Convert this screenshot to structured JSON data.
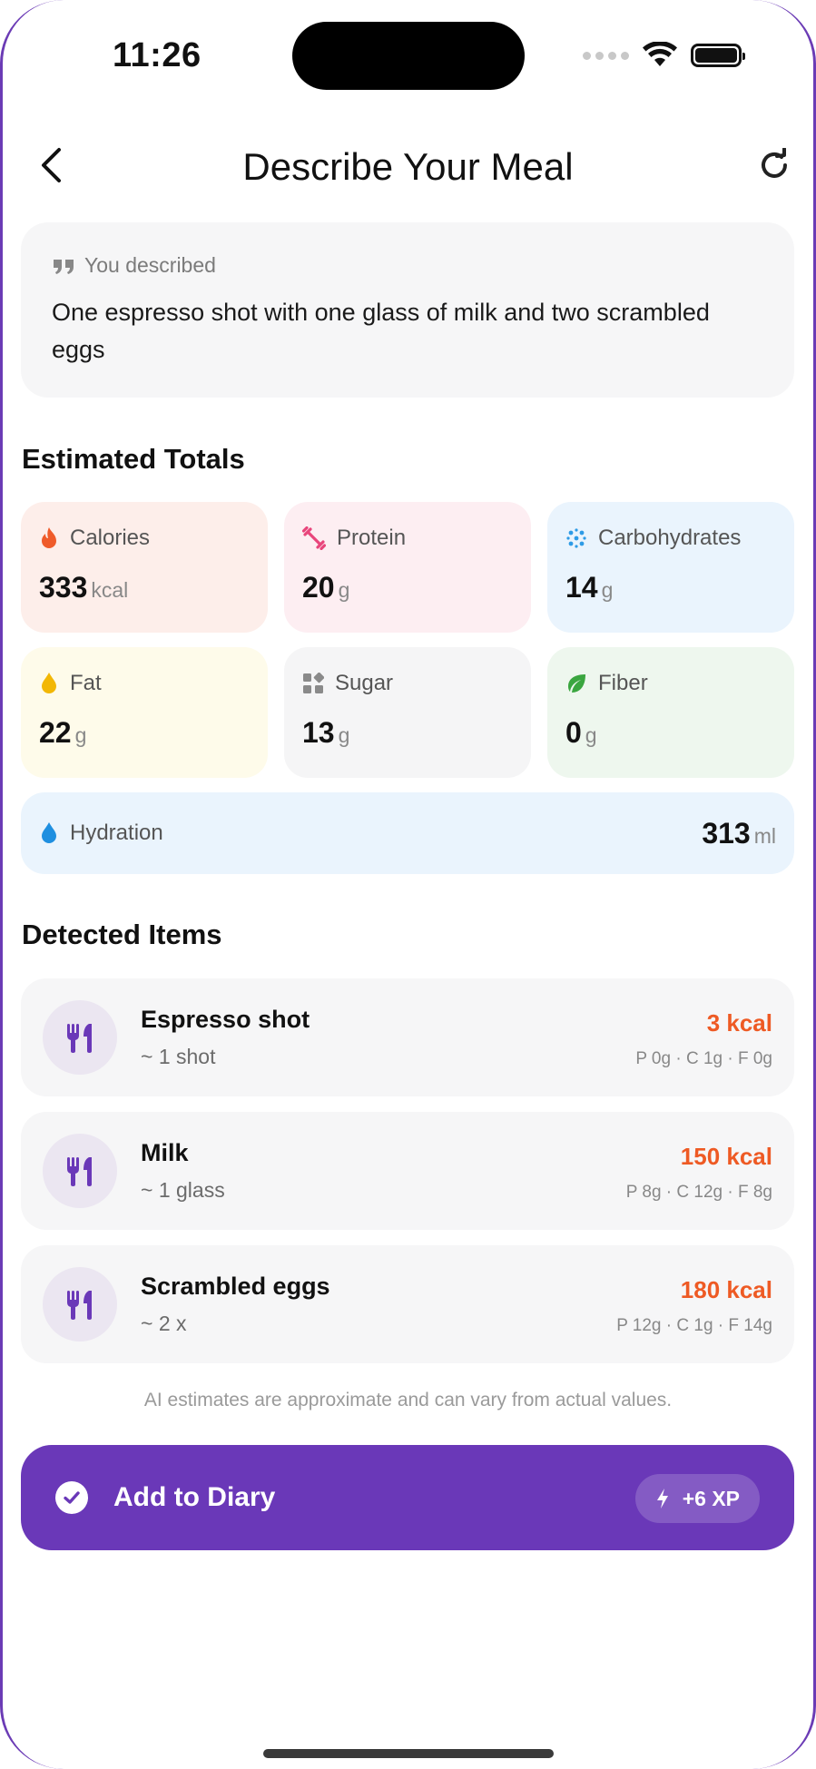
{
  "status_bar": {
    "time": "11:26"
  },
  "header": {
    "title": "Describe Your Meal"
  },
  "description": {
    "label": "You described",
    "text": "One espresso shot with one glass of milk and two scrambled eggs"
  },
  "totals": {
    "title": "Estimated Totals",
    "calories": {
      "label": "Calories",
      "value": "333",
      "unit": "kcal"
    },
    "protein": {
      "label": "Protein",
      "value": "20",
      "unit": "g"
    },
    "carbs": {
      "label": "Carbohydrates",
      "value": "14",
      "unit": "g"
    },
    "fat": {
      "label": "Fat",
      "value": "22",
      "unit": "g"
    },
    "sugar": {
      "label": "Sugar",
      "value": "13",
      "unit": "g"
    },
    "fiber": {
      "label": "Fiber",
      "value": "0",
      "unit": "g"
    },
    "hydration": {
      "label": "Hydration",
      "value": "313",
      "unit": "ml"
    }
  },
  "items": {
    "title": "Detected Items",
    "list": [
      {
        "name": "Espresso shot",
        "qty": "~ 1 shot",
        "kcal": "3 kcal",
        "macros": "P 0g · C 1g · F 0g"
      },
      {
        "name": "Milk",
        "qty": "~ 1 glass",
        "kcal": "150 kcal",
        "macros": "P 8g · C 12g · F 8g"
      },
      {
        "name": "Scrambled eggs",
        "qty": "~ 2 x",
        "kcal": "180 kcal",
        "macros": "P 12g · C 1g · F 14g"
      }
    ]
  },
  "disclaimer": "AI estimates are approximate and can vary from actual values.",
  "add_button": {
    "label": "Add to Diary",
    "xp": "+6 XP"
  },
  "colors": {
    "accent": "#6a38b8",
    "kcal": "#ee5a24",
    "calories_bg": "#fdeeea",
    "protein_bg": "#fdeef2",
    "carbs_bg": "#eaf4fd",
    "fat_bg": "#fefbea",
    "sugar_bg": "#f5f5f6",
    "fiber_bg": "#eef7ee"
  },
  "icons": {
    "back": "chevron-left-icon",
    "refresh": "refresh-icon",
    "quote": "quote-icon",
    "calories": "flame-icon",
    "protein": "dumbbell-icon",
    "carbs": "grain-icon",
    "fat": "drop-icon",
    "sugar": "cubes-icon",
    "fiber": "leaf-icon",
    "hydration": "water-drop-icon",
    "item": "utensils-icon",
    "check": "check-circle-icon",
    "xp": "bolt-icon"
  }
}
